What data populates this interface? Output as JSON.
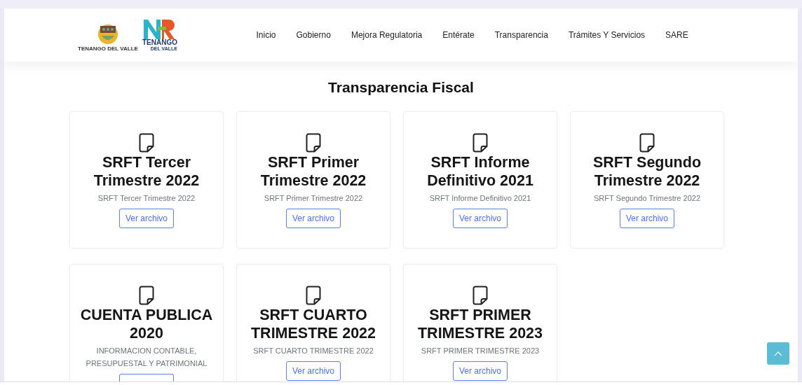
{
  "logos": [
    {
      "caption": "TENANGO DEL VALLE"
    },
    {
      "line_1": "TENANGO",
      "line_2": "DEL VALLE"
    }
  ],
  "nav": [
    {
      "label": "Inicio"
    },
    {
      "label": "Gobierno"
    },
    {
      "label": "Mejora Regulatoria"
    },
    {
      "label": "Entérate"
    },
    {
      "label": "Transparencia"
    },
    {
      "label": "Trámites Y Servicios"
    },
    {
      "label": "SARE"
    }
  ],
  "page_title": "Transparencia Fiscal",
  "cards": [
    {
      "title": "SRFT Tercer Trimestre 2022",
      "description": "SRFT Tercer Trimestre 2022",
      "button": "Ver archivo"
    },
    {
      "title": "SRFT Primer Trimestre 2022",
      "description": "SRFT Primer Trimestre 2022",
      "button": "Ver archivo"
    },
    {
      "title": "SRFT Informe Definitivo 2021",
      "description": "SRFT Informe Definitivo 2021",
      "button": "Ver archivo"
    },
    {
      "title": "SRFT Segundo Trimestre 2022",
      "description": "SRFT Segundo Trimestre 2022",
      "button": "Ver archivo"
    },
    {
      "title": "CUENTA PUBLICA 2020",
      "description": "INFORMACION CONTABLE, PRESUPUESTAL Y PATRIMONIAL"
    },
    {
      "title": "SRFT CUARTO TRIMESTRE 2022",
      "description": "SRFT CUARTO TRIMESTRE 2022",
      "button": "Ver archivo"
    },
    {
      "title": "SRFT PRIMER TRIMESTRE 2023",
      "description": "SRFT PRIMER TRIMESTRE 2023",
      "button": "Ver archivo"
    }
  ]
}
